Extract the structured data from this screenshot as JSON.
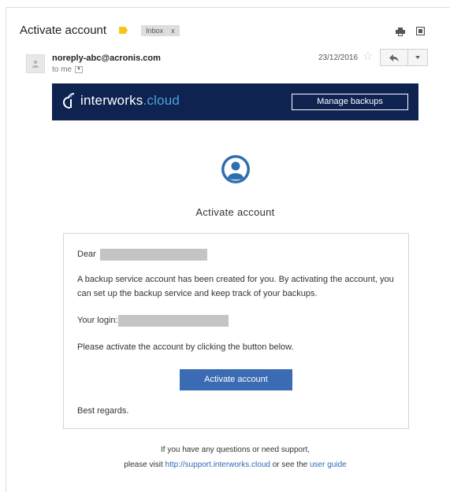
{
  "email": {
    "subject": "Activate account",
    "label": "Inbox",
    "label_close": "x",
    "sender": "noreply-abc@acronis.com",
    "recipient_text": "to me",
    "date": "23/12/2016"
  },
  "banner": {
    "brand": "interworks",
    "brand_suffix": ".cloud",
    "manage_label": "Manage backups",
    "background": "#0f2350"
  },
  "body": {
    "headline": "Activate account",
    "greeting": "Dear",
    "paragraph": "A backup service account has been created for you. By activating the account, you can set up the backup service and keep track of your backups.",
    "login_label": "Your login:",
    "instruction": "Please activate the account by clicking the button below.",
    "button_label": "Activate account",
    "signoff": "Best regards."
  },
  "footer": {
    "line1": "If you have any questions or need support,",
    "line2_prefix": "please visit",
    "support_link": "http://support.interworks.cloud",
    "line2_middle": "or see the",
    "guide_link": "user guide"
  },
  "colors": {
    "accent": "#3b6cb3",
    "link": "#2d6bb7",
    "label_tag": "#f5c518"
  },
  "icons": [
    "label-tag-icon",
    "print-icon",
    "new-window-icon",
    "avatar-icon",
    "star-icon",
    "reply-icon",
    "more-options-icon",
    "user-icon",
    "logo-icon"
  ]
}
